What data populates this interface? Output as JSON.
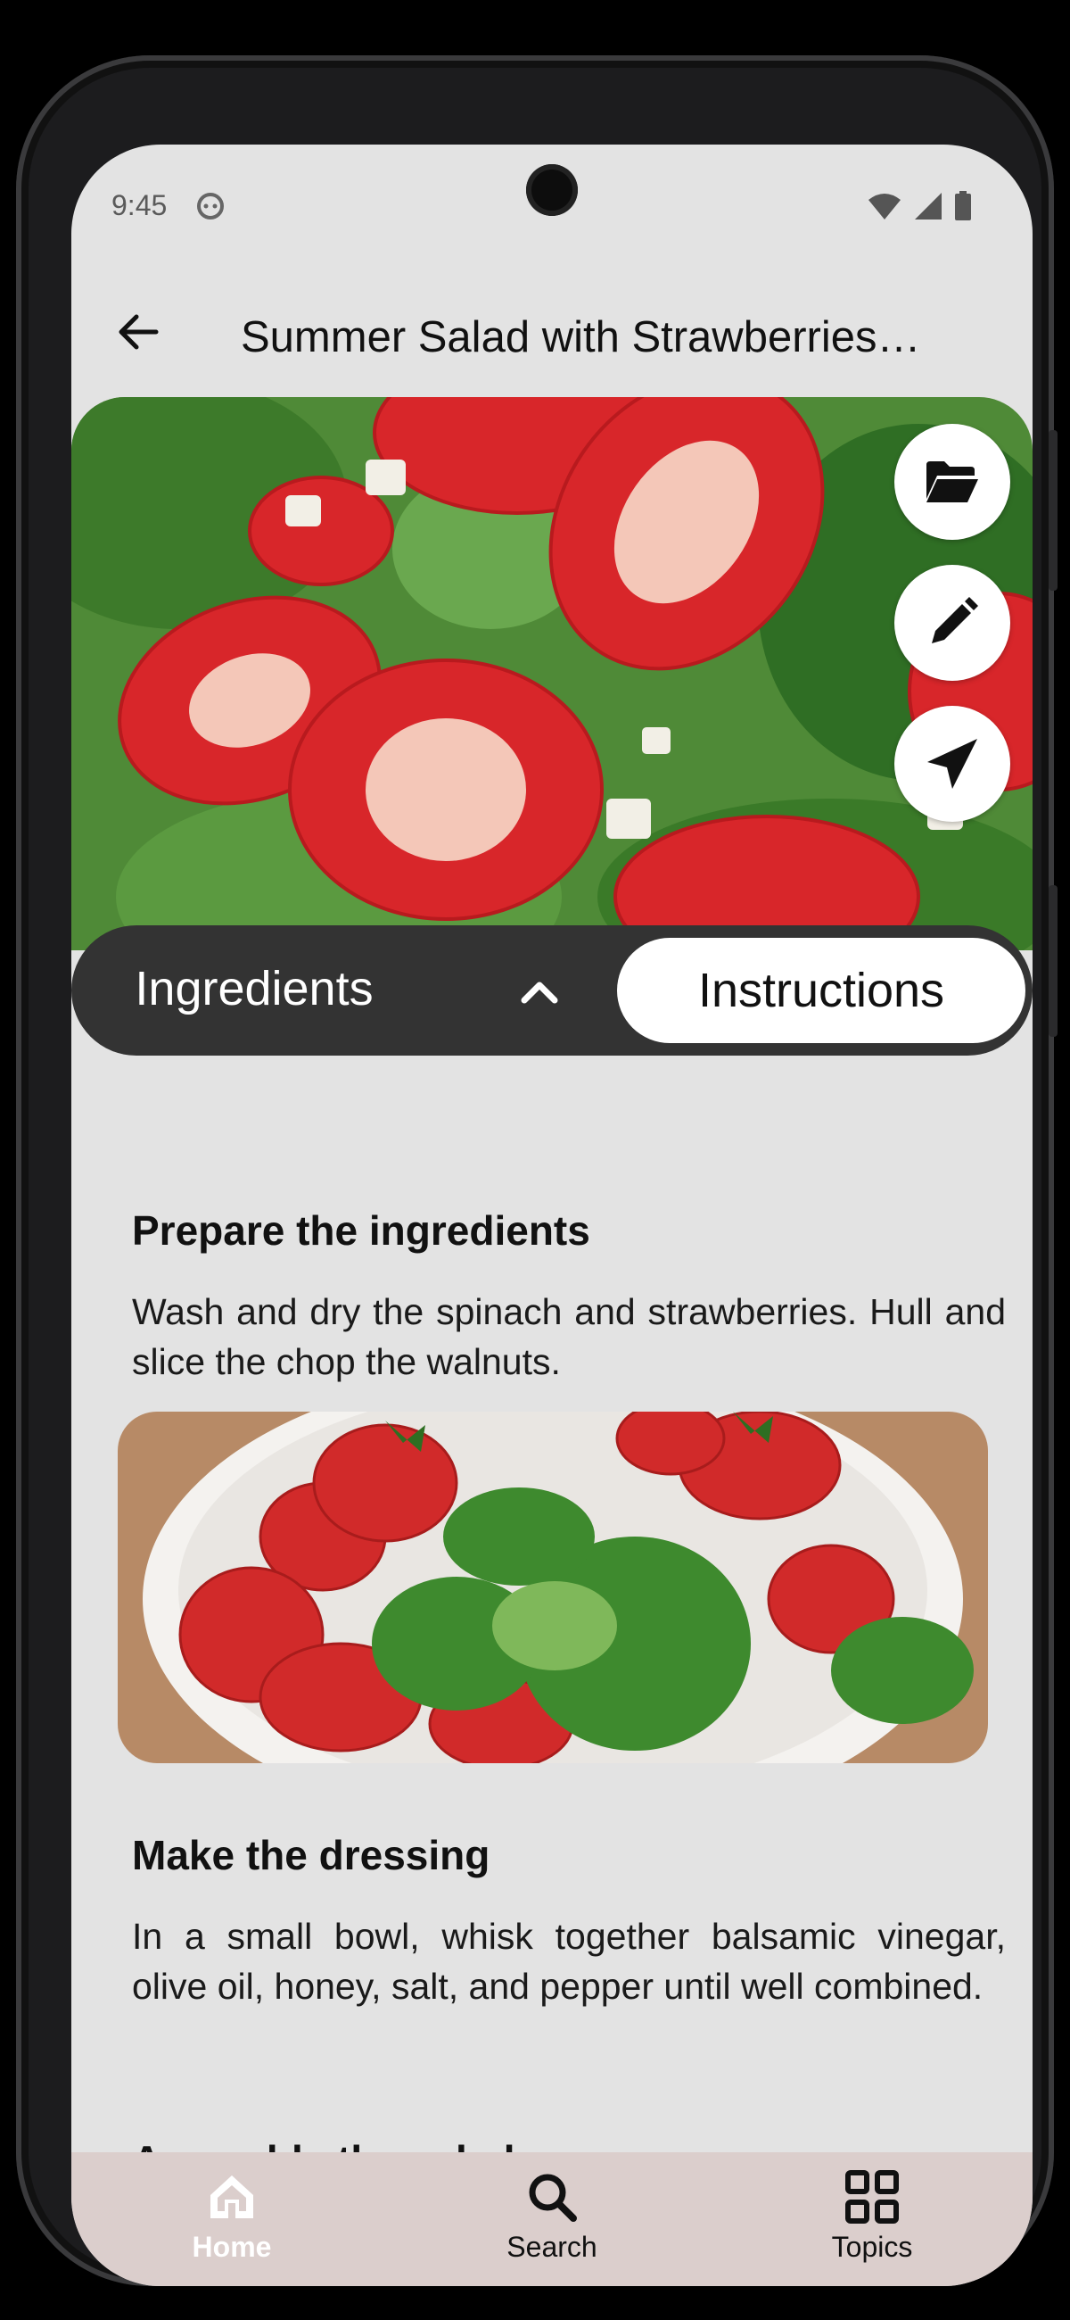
{
  "status_bar": {
    "time": "9:45"
  },
  "app_bar": {
    "title": "Summer Salad with Strawberries…"
  },
  "actions": {
    "folder": "folder-open-icon",
    "edit": "pencil-icon",
    "share": "send-icon"
  },
  "tabs": {
    "ingredients_label": "Ingredients",
    "instructions_label": "Instructions",
    "selected": "Instructions"
  },
  "steps": [
    {
      "title": "Prepare the ingredients",
      "body": "Wash and dry the spinach and strawberries. Hull and slice the  chop the walnuts."
    },
    {
      "title": "Make the dressing",
      "body": "In a small bowl, whisk together balsamic vinegar, olive oil, honey, salt, and pepper until well combined."
    },
    {
      "title": "Assemble the salad",
      "body": ""
    }
  ],
  "bottom_nav": [
    {
      "label": "Home",
      "icon": "home-icon",
      "selected": true
    },
    {
      "label": "Search",
      "icon": "search-icon",
      "selected": false
    },
    {
      "label": "Topics",
      "icon": "grid-icon",
      "selected": false
    }
  ],
  "colors": {
    "segment_bg": "#333333",
    "nav_bg": "#dbcecc",
    "screen_bg": "#e3e3e3",
    "strawberry": "#d8262a",
    "spinach": "#3f7a2e"
  }
}
